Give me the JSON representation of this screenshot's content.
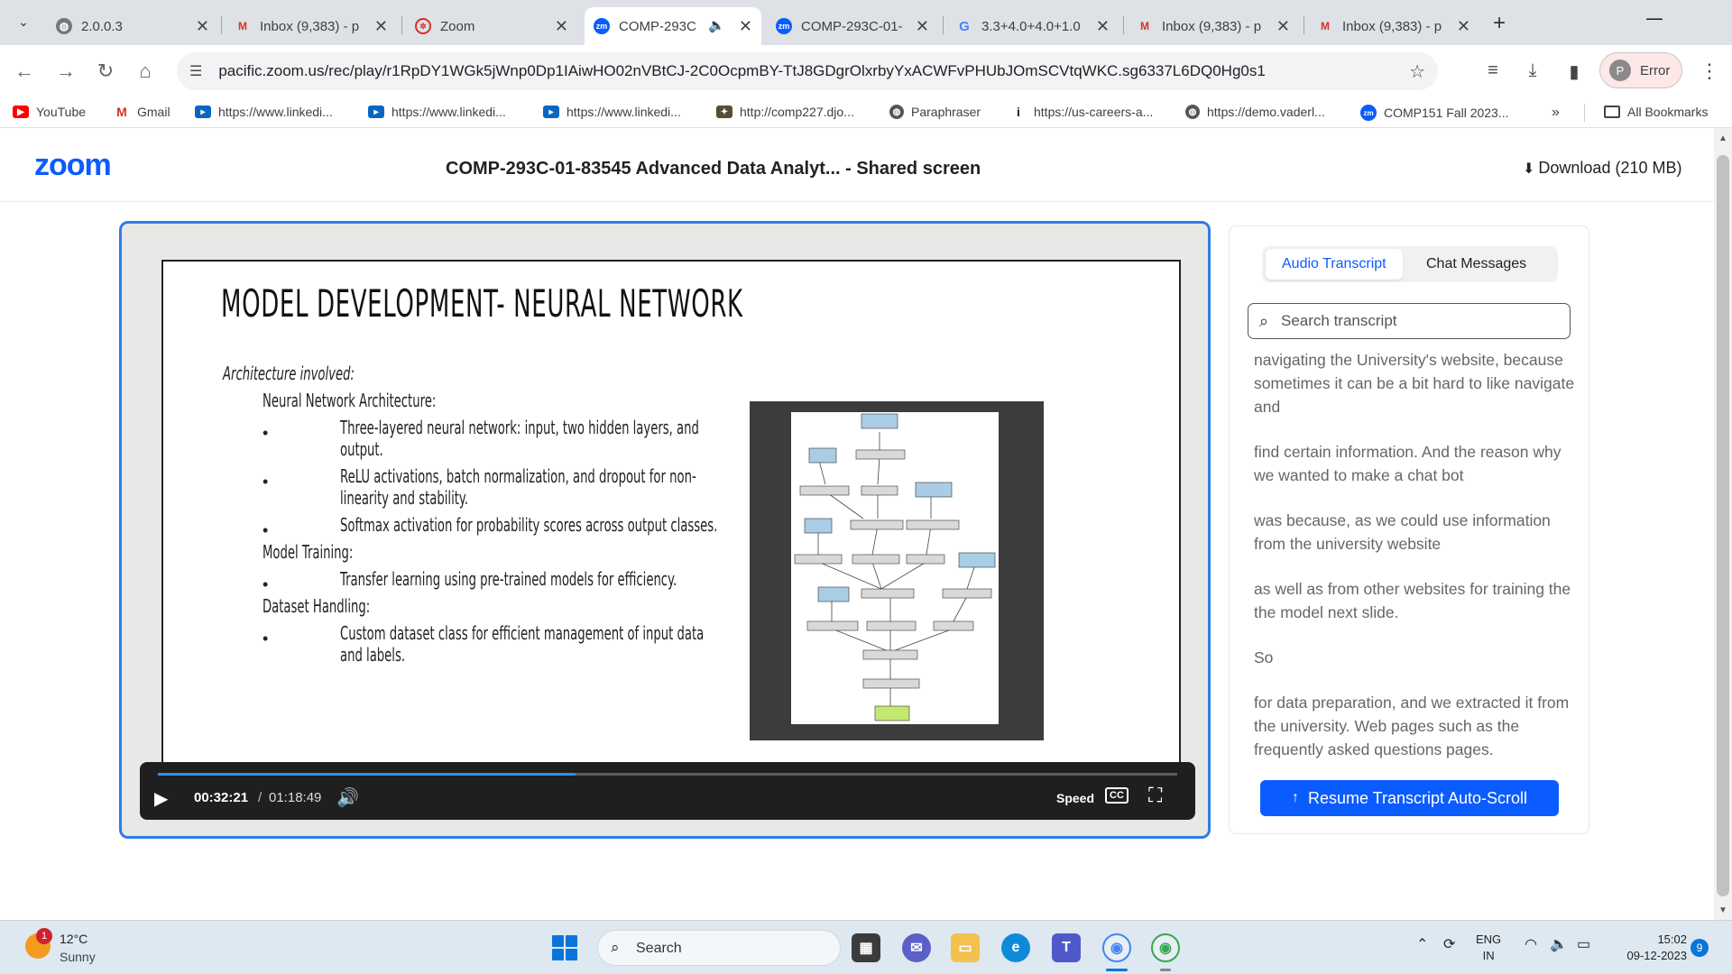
{
  "browser": {
    "tabs": [
      {
        "title": "2.0.0.3",
        "icon": "globe-icon"
      },
      {
        "title": "Inbox (9,383) - p",
        "icon": "gmail-icon"
      },
      {
        "title": "Zoom",
        "icon": "zoom-logo-icon"
      },
      {
        "title": "COMP-293C",
        "icon": "zoom-app-icon",
        "active": true
      },
      {
        "title": "COMP-293C-01-",
        "icon": "zoom-app-icon"
      },
      {
        "title": "3.3+4.0+4.0+1.0",
        "icon": "google-icon"
      },
      {
        "title": "Inbox (9,383) - p",
        "icon": "gmail-icon"
      },
      {
        "title": "Inbox (9,383) - p",
        "icon": "gmail-icon"
      }
    ],
    "url": "pacific.zoom.us/rec/play/r1RpDY1WGk5jWnp0Dp1IAiwHO02nVBtCJ-2C0OcpmBY-TtJ8GDgrOlxrbyYxACWFvPHUbJOmSCVtqWKC.sg6337L6DQ0Hg0s1",
    "profile_label": "Error",
    "profile_initial": "P",
    "bookmarks": [
      {
        "label": "YouTube",
        "icon": "youtube-icon"
      },
      {
        "label": "Gmail",
        "icon": "gmail-icon"
      },
      {
        "label": "https://www.linkedi...",
        "icon": "linkedin-learning-icon"
      },
      {
        "label": "https://www.linkedi...",
        "icon": "linkedin-learning-icon"
      },
      {
        "label": "https://www.linkedi...",
        "icon": "linkedin-learning-icon"
      },
      {
        "label": "http://comp227.djo...",
        "icon": "django-icon"
      },
      {
        "label": "Paraphraser",
        "icon": "globe-icon"
      },
      {
        "label": "https://us-careers-a...",
        "icon": "info-icon"
      },
      {
        "label": "https://demo.vaderl...",
        "icon": "globe-icon"
      },
      {
        "label": "COMP151 Fall 2023...",
        "icon": "zoom-app-icon"
      }
    ],
    "all_bookmarks_label": "All Bookmarks"
  },
  "zoom": {
    "logo": "zoom",
    "recording_title": "COMP-293C-01-83545 Advanced Data Analyt... - Shared screen",
    "download_label": "Download (210 MB)",
    "slide": {
      "title": "MODEL DEVELOPMENT- NEURAL NETWORK",
      "intro": "Architecture involved:",
      "sections": [
        {
          "heading": "Neural Network Architecture:",
          "bullets": [
            [
              "Three-layered neural network: input, two hidden layers, and",
              "output."
            ],
            [
              "ReLU activations, batch normalization, and dropout for non-",
              "linearity and stability."
            ],
            [
              "Softmax activation for probability scores across output classes."
            ]
          ]
        },
        {
          "heading": "Model Training:",
          "bullets": [
            [
              "Transfer learning using pre-trained models for efficiency."
            ]
          ]
        },
        {
          "heading": "Dataset Handling:",
          "bullets": [
            [
              "Custom dataset class for efficient management of input data",
              "and labels."
            ]
          ]
        }
      ]
    },
    "player": {
      "current_time": "00:32:21",
      "separator": "/",
      "total_time": "01:18:49",
      "progress_fraction": 0.41,
      "speed_label": "Speed",
      "cc_label": "CC"
    },
    "transcript": {
      "tabs": [
        "Audio Transcript",
        "Chat Messages"
      ],
      "active_tab": 0,
      "search_placeholder": "Search transcript",
      "paragraphs": [
        "navigating the University's website, because sometimes it can be a bit hard to like navigate and",
        "find certain information. And the reason why we wanted to make a chat bot",
        "was because, as we could use information from the university website",
        "as well as from other websites for training the the model next slide.",
        "So",
        "for data preparation, and we extracted it from the university. Web pages such as the frequently asked questions pages."
      ],
      "resume_label": "Resume Transcript Auto-Scroll"
    }
  },
  "taskbar": {
    "weather_temp": "12°C",
    "weather_condition": "Sunny",
    "weather_badge": "1",
    "search_label": "Search",
    "lang_top": "ENG",
    "lang_bottom": "IN",
    "time": "15:02",
    "date": "09-12-2023",
    "notifications": "9"
  },
  "colors": {
    "zoom_blue": "#0b5cff",
    "player_border": "#2f7de6",
    "progress": "#2d8cff"
  }
}
